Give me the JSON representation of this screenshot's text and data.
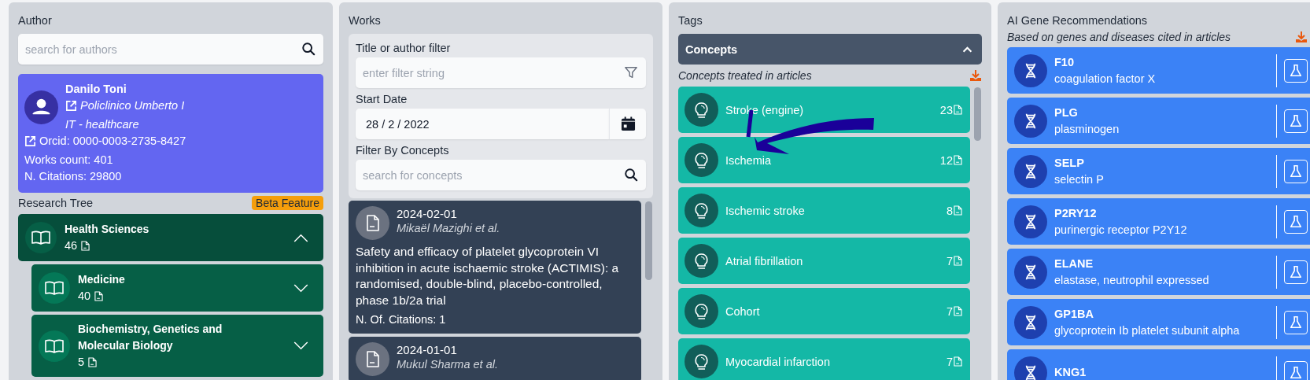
{
  "author_panel": {
    "title": "Author",
    "search": {
      "placeholder": "search for authors"
    },
    "author": {
      "name": "Danilo Toni",
      "institution": "Policlinico Umberto I",
      "country_type": "IT - healthcare",
      "orcid": "Orcid: 0000-0003-2735-8427",
      "works_count": "Works count: 401",
      "citations": "N. Citations: 29800"
    },
    "research_tree": {
      "title": "Research Tree",
      "badge": "Beta Feature",
      "nodes": [
        {
          "label": "Health Sciences",
          "count": "46",
          "expanded": true,
          "children": [
            {
              "label": "Medicine",
              "count": "40",
              "expanded": false
            },
            {
              "label": "Biochemistry, Genetics and Molecular Biology",
              "count": "5",
              "expanded": false
            }
          ]
        }
      ]
    }
  },
  "works_panel": {
    "title": "Works",
    "filters": {
      "title_label": "Title or author filter",
      "title_placeholder": "enter filter string",
      "date_label": "Start Date",
      "date_value": "28 / 2 / 2022",
      "concepts_label": "Filter By Concepts",
      "concepts_placeholder": "search for concepts"
    },
    "works": [
      {
        "date": "2024-02-01",
        "authors": "Mikaël Mazighi et al.",
        "title": "Safety and efficacy of platelet glycoprotein VI inhibition in acute ischaemic stroke (ACTIMIS): a randomised, double-blind, placebo-controlled, phase 1b/2a trial",
        "citations": "N. Of. Citations: 1"
      },
      {
        "date": "2024-01-01",
        "authors": "Mukul Sharma et al."
      }
    ]
  },
  "tags_panel": {
    "title": "Tags",
    "section": {
      "title": "Concepts",
      "expanded": true
    },
    "subtitle": "Concepts treated in articles",
    "concepts": [
      {
        "label": "Stroke (engine)",
        "count": "23"
      },
      {
        "label": "Ischemia",
        "count": "12"
      },
      {
        "label": "Ischemic stroke",
        "count": "8"
      },
      {
        "label": "Atrial fibrillation",
        "count": "7"
      },
      {
        "label": "Cohort",
        "count": "7"
      },
      {
        "label": "Myocardial infarction",
        "count": "7"
      }
    ]
  },
  "genes_panel": {
    "title": "AI Gene Recommendations",
    "subtitle": "Based on genes and diseases cited in articles",
    "genes": [
      {
        "symbol": "F10",
        "name": "coagulation factor X"
      },
      {
        "symbol": "PLG",
        "name": "plasminogen"
      },
      {
        "symbol": "SELP",
        "name": "selectin P"
      },
      {
        "symbol": "P2RY12",
        "name": "purinergic receptor P2Y12"
      },
      {
        "symbol": "ELANE",
        "name": "elastase, neutrophil expressed"
      },
      {
        "symbol": "GP1BA",
        "name": "glycoprotein Ib platelet subunit alpha"
      },
      {
        "symbol": "KNG1"
      }
    ]
  }
}
